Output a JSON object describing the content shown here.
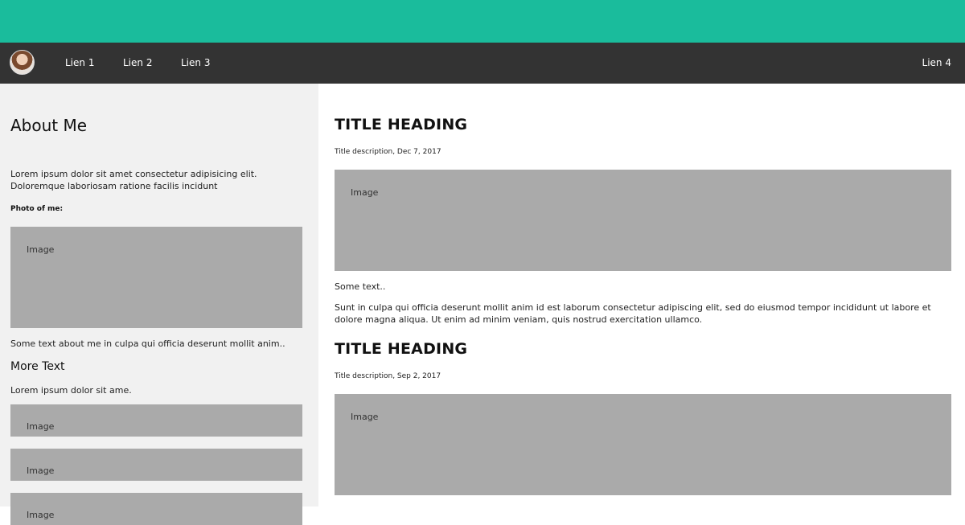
{
  "colors": {
    "topbar": "#1abc9c",
    "navbar": "#333333",
    "sidebar": "#f1f1f1",
    "placeholder": "#aaaaaa"
  },
  "nav": {
    "avatar_icon": "user-avatar-icon",
    "links": [
      "Lien 1",
      "Lien 2",
      "Lien 3"
    ],
    "right_link": "Lien 4"
  },
  "sidebar": {
    "title": "About Me",
    "intro": "Lorem ipsum dolor sit amet consectetur adipisicing elit. Doloremque laboriosam ratione facilis incidunt",
    "photo_label": "Photo of me:",
    "photo_image_label": "Image",
    "about_text": "Some text about me in culpa qui officia deserunt mollit anim..",
    "more_title": "More Text",
    "more_text": "Lorem ipsum dolor sit ame.",
    "images": [
      "Image",
      "Image",
      "Image"
    ]
  },
  "posts": [
    {
      "title": "TITLE HEADING",
      "description": "Title description, Dec 7, 2017",
      "image_label": "Image",
      "text": "Some text..",
      "body": "Sunt in culpa qui officia deserunt mollit anim id est laborum consectetur adipiscing elit, sed do eiusmod tempor incididunt ut labore et dolore magna aliqua. Ut enim ad minim veniam, quis nostrud exercitation ullamco."
    },
    {
      "title": "TITLE HEADING",
      "description": "Title description, Sep 2, 2017",
      "image_label": "Image"
    }
  ]
}
